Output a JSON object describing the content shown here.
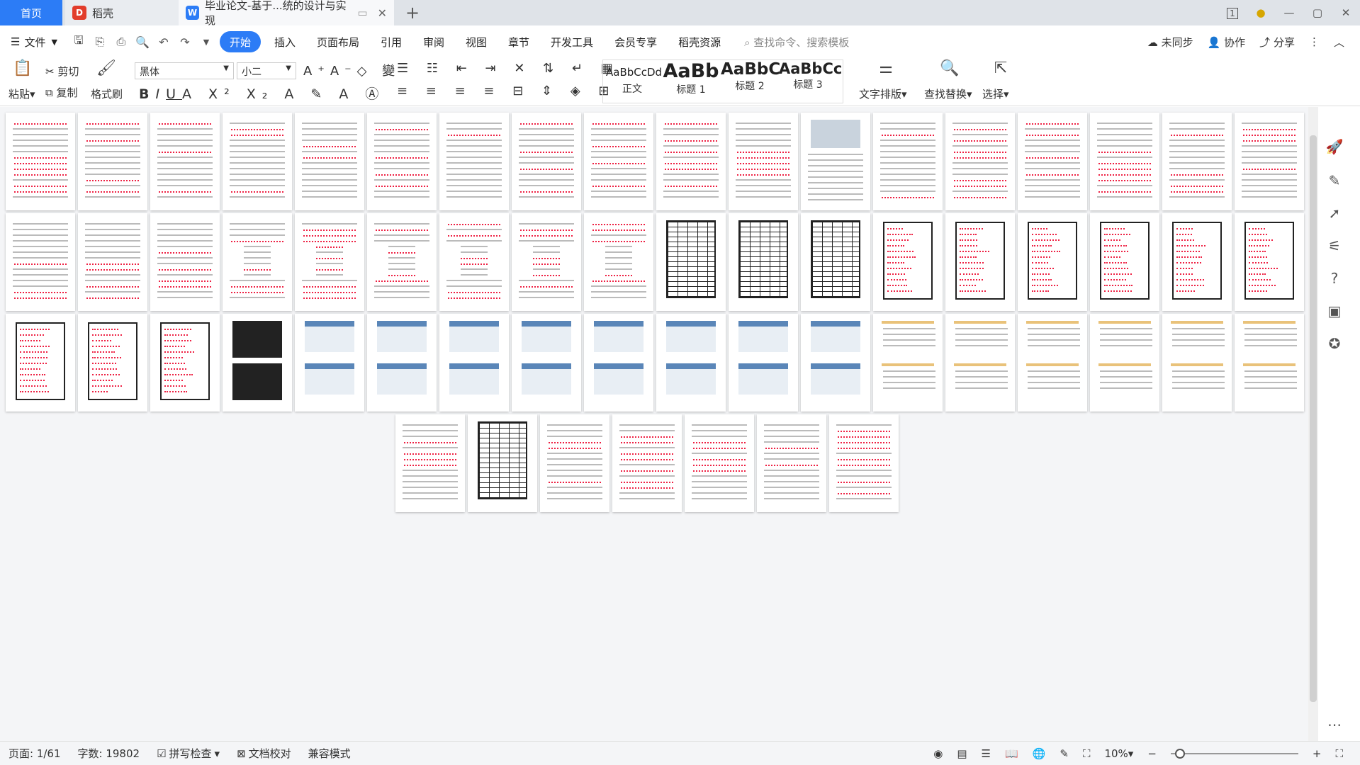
{
  "titlebar": {
    "tabs": [
      {
        "label": "首页",
        "icon": "home"
      },
      {
        "label": "稻壳",
        "icon": "daoke-logo-icon"
      },
      {
        "label": "毕业论文-基于...统的设计与实现",
        "icon": "word-doc-icon"
      }
    ],
    "window_badge": "1"
  },
  "menubar": {
    "file": "文件",
    "items": [
      "开始",
      "插入",
      "页面布局",
      "引用",
      "审阅",
      "视图",
      "章节",
      "开发工具",
      "会员专享",
      "稻壳资源"
    ],
    "active": "开始",
    "search_placeholder": "查找命令、搜索模板",
    "right": {
      "sync": "未同步",
      "collab": "协作",
      "share": "分享"
    }
  },
  "ribbon": {
    "paste": "粘贴",
    "cut": "剪切",
    "copy": "复制",
    "format_painter": "格式刷",
    "font_name": "黑体",
    "font_size": "小二",
    "styles": [
      {
        "sample": "AaBbCcDd",
        "label": "正文"
      },
      {
        "sample": "AaBb",
        "label": "标题 1"
      },
      {
        "sample": "AaBbC",
        "label": "标题 2"
      },
      {
        "sample": "AaBbCc",
        "label": "标题 3"
      }
    ],
    "text_layout": "文字排版",
    "find_replace": "查找替换",
    "select": "选择"
  },
  "statusbar": {
    "page": "页面: 1/61",
    "words": "字数: 19802",
    "spell": "拼写检查",
    "proof": "文档校对",
    "compat": "兼容模式",
    "zoom": "10%"
  },
  "colors": {
    "accent": "#2c7cf6",
    "error_underline": "#e02040"
  }
}
